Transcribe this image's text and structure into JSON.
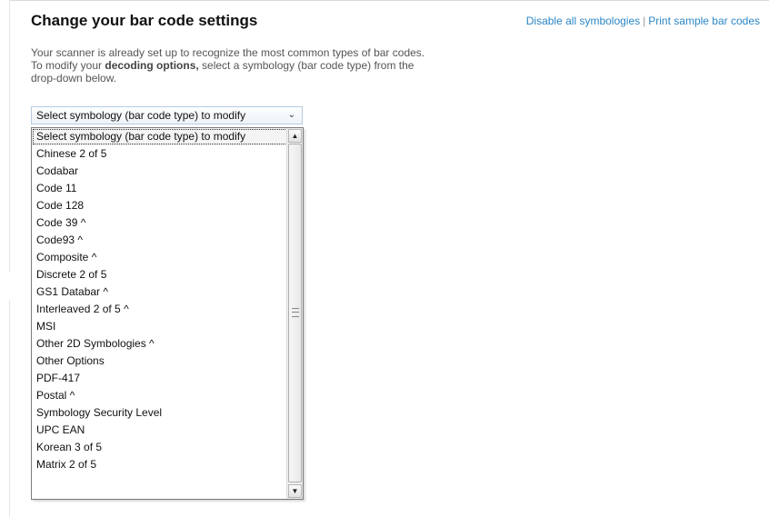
{
  "header": {
    "title": "Change your bar code settings",
    "disable_link": "Disable all symbologies",
    "separator": "|",
    "print_link": "Print sample bar codes"
  },
  "intro": {
    "text_before": "Your scanner is already set up to recognize the most common types of bar codes. To modify your ",
    "bold": "decoding options,",
    "text_after": " select a symbology (bar code type) from the drop-down below."
  },
  "symbology_select": {
    "selected_value": "Select symbology (bar code type) to modify",
    "chevron_icon": "chevron-down-icon",
    "options": [
      "Select symbology (bar code type) to modify",
      "Chinese 2 of 5",
      "Codabar",
      "Code 11",
      "Code 128",
      "Code 39 ^",
      "Code93 ^",
      "Composite ^",
      "Discrete 2 of 5",
      "GS1 Databar ^",
      "Interleaved 2 of 5 ^",
      "MSI",
      "Other 2D Symbologies ^",
      "Other Options",
      "PDF-417",
      "Postal ^",
      "Symbology Security Level",
      "UPC EAN",
      "Korean 3 of 5",
      "Matrix 2 of 5"
    ],
    "highlighted_index": 0
  },
  "colors": {
    "link": "#2b86c5",
    "title": "#111111",
    "body_text": "#555555"
  }
}
